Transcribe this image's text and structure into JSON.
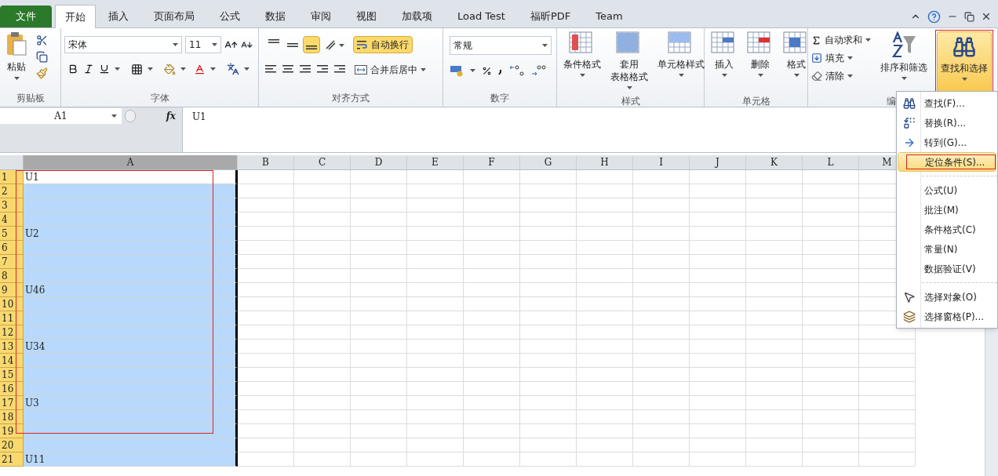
{
  "tabs": [
    {
      "label": "文件",
      "kind": "file",
      "selected": false
    },
    {
      "label": "开始",
      "kind": "tab",
      "selected": true
    },
    {
      "label": "插入",
      "kind": "tab",
      "selected": false
    },
    {
      "label": "页面布局",
      "kind": "tab",
      "selected": false
    },
    {
      "label": "公式",
      "kind": "tab",
      "selected": false
    },
    {
      "label": "数据",
      "kind": "tab",
      "selected": false
    },
    {
      "label": "审阅",
      "kind": "tab",
      "selected": false
    },
    {
      "label": "视图",
      "kind": "tab",
      "selected": false
    },
    {
      "label": "加载项",
      "kind": "tab",
      "selected": false
    },
    {
      "label": "Load Test",
      "kind": "tab",
      "selected": false
    },
    {
      "label": "福昕PDF",
      "kind": "tab",
      "selected": false
    },
    {
      "label": "Team",
      "kind": "tab",
      "selected": false
    }
  ],
  "ribbon": {
    "clipboard": {
      "paste": "粘贴",
      "label": "剪贴板"
    },
    "font": {
      "name": "宋体",
      "size": "11",
      "label": "字体"
    },
    "alignment": {
      "vertical": [
        {
          "selected": false
        },
        {
          "selected": false
        },
        {
          "selected": true
        }
      ],
      "wrap": {
        "label": "自动换行",
        "on": true
      },
      "merge": "合并后居中",
      "label": "对齐方式"
    },
    "number": {
      "format": "常规",
      "label": "数字"
    },
    "styles": {
      "buttons": [
        {
          "lines": [
            "条件格式"
          ]
        },
        {
          "lines": [
            "套用",
            "表格格式"
          ]
        },
        {
          "lines": [
            "单元格样式"
          ]
        }
      ],
      "label": "样式"
    },
    "cells": {
      "buttons": [
        "插入",
        "删除",
        "格式"
      ],
      "label": "单元格"
    },
    "editing": {
      "small": [
        "自动求和",
        "填充",
        "清除"
      ],
      "sort": "排序和筛选",
      "find": {
        "label": "查找和选择",
        "selected": true
      },
      "label": "编"
    }
  },
  "formula_bar": {
    "name_box": "A1",
    "fx": "fx",
    "value": "U1"
  },
  "sheet": {
    "columns": [
      {
        "label": "A",
        "selected": true
      },
      {
        "label": "B",
        "selected": false
      },
      {
        "label": "C",
        "selected": false
      },
      {
        "label": "D",
        "selected": false
      },
      {
        "label": "E",
        "selected": false
      },
      {
        "label": "F",
        "selected": false
      },
      {
        "label": "G",
        "selected": false
      },
      {
        "label": "H",
        "selected": false
      },
      {
        "label": "I",
        "selected": false
      },
      {
        "label": "J",
        "selected": false
      },
      {
        "label": "K",
        "selected": false
      },
      {
        "label": "L",
        "selected": false
      },
      {
        "label": "M",
        "selected": false
      }
    ],
    "rows": [
      {
        "header": "1",
        "cell": "U1",
        "selected": true,
        "active": true
      },
      {
        "header": "2",
        "selected": true,
        "active": false
      },
      {
        "header": "3",
        "selected": true,
        "active": false
      },
      {
        "header": "4",
        "selected": true,
        "active": false
      },
      {
        "header": "5",
        "cell": "U2",
        "selected": true,
        "active": false
      },
      {
        "header": "6",
        "selected": true,
        "active": false
      },
      {
        "header": "7",
        "selected": true,
        "active": false
      },
      {
        "header": "8",
        "selected": true,
        "active": false
      },
      {
        "header": "9",
        "cell": "U46",
        "selected": true,
        "active": false
      },
      {
        "header": "10",
        "selected": true,
        "active": false
      },
      {
        "header": "11",
        "selected": true,
        "active": false
      },
      {
        "header": "12",
        "selected": true,
        "active": false
      },
      {
        "header": "13",
        "cell": "U34",
        "selected": true,
        "active": false
      },
      {
        "header": "14",
        "selected": true,
        "active": false
      },
      {
        "header": "15",
        "selected": true,
        "active": false
      },
      {
        "header": "16",
        "selected": true,
        "active": false
      },
      {
        "header": "17",
        "cell": "U3",
        "selected": true,
        "active": false
      },
      {
        "header": "18",
        "selected": true,
        "active": false
      },
      {
        "header": "19",
        "selected": true,
        "active": false
      },
      {
        "header": "20",
        "selected": true,
        "active": false
      },
      {
        "header": "21",
        "cell": "U11",
        "selected": true,
        "active": false
      }
    ]
  },
  "menu": {
    "items": [
      {
        "kind": "item",
        "label": "查找(F)...",
        "highlighted": false
      },
      {
        "kind": "item",
        "label": "替换(R)...",
        "highlighted": false
      },
      {
        "kind": "item",
        "label": "转到(G)...",
        "highlighted": false
      },
      {
        "kind": "item",
        "label": "定位条件(S)...",
        "highlighted": true
      },
      {
        "kind": "separator"
      },
      {
        "kind": "item",
        "label": "公式(U)",
        "highlighted": false
      },
      {
        "kind": "item",
        "label": "批注(M)",
        "highlighted": false
      },
      {
        "kind": "item",
        "label": "条件格式(C)",
        "highlighted": false
      },
      {
        "kind": "item",
        "label": "常量(N)",
        "highlighted": false
      },
      {
        "kind": "item",
        "label": "数据验证(V)",
        "highlighted": false
      },
      {
        "kind": "separator"
      },
      {
        "kind": "item",
        "label": "选择对象(O)",
        "highlighted": false
      },
      {
        "kind": "item",
        "label": "选择窗格(P)...",
        "highlighted": false
      }
    ]
  }
}
